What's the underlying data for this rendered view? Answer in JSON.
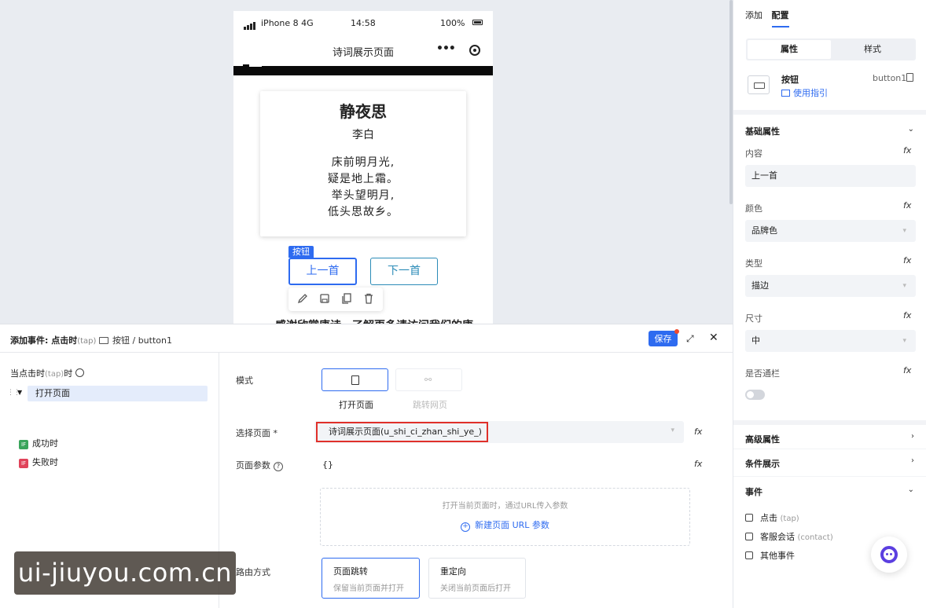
{
  "phone": {
    "carrier": "iPhone 8  4G",
    "time": "14:58",
    "battery": "100%",
    "page_title": "诗词展示页面",
    "more": "•••",
    "poem": {
      "title": "静夜思",
      "author": "李白",
      "lines": [
        "床前明月光,",
        "疑是地上霜。",
        "举头望明月,",
        "低头思故乡。"
      ]
    },
    "selected_tag": "按钮",
    "prev_button": "上一首",
    "next_button": "下一首",
    "cut_text": "感谢欣赏唐诗，了解更多请访问我们的康"
  },
  "right_panel": {
    "tabs": [
      "添加",
      "配置"
    ],
    "segment": [
      "属性",
      "样式"
    ],
    "component": {
      "name": "按钮",
      "id": "button1",
      "guide": "使用指引"
    },
    "basic_section": "基础属性",
    "props": {
      "content_label": "内容",
      "content_value": "上一首",
      "color_label": "颜色",
      "color_value": "品牌色",
      "type_label": "类型",
      "type_value": "描边",
      "size_label": "尺寸",
      "size_value": "中",
      "block_label": "是否通栏"
    },
    "fx": "fx",
    "advanced_section": "高级属性",
    "conditional_section": "条件展示",
    "events_section": "事件",
    "events": [
      {
        "label": "点击",
        "sub": "(tap)"
      },
      {
        "label": "客服会话",
        "sub": "(contact)"
      },
      {
        "label": "其他事件",
        "sub": ""
      }
    ]
  },
  "dialog": {
    "title": "添加事件: 点击时",
    "title_sub": "(tap)",
    "target": "按钮 / button1",
    "save": "保存",
    "tree": {
      "head": "当点击时",
      "head_sub": "(tap)",
      "head_end": "时",
      "action": "打开页面",
      "success": "成功时",
      "fail": "失败时",
      "if_badge": "IF"
    },
    "mode_label": "模式",
    "mode_open": "打开页面",
    "mode_jump": "跳转网页",
    "page_label": "选择页面 *",
    "page_value": "诗词展示页面(u_shi_ci_zhan_shi_ye_)",
    "params_label": "页面参数",
    "params_value": "{}",
    "params_hint": "打开当前页面时，通过URL传入参数",
    "params_add": "新建页面 URL 参数",
    "route_label": "路由方式",
    "route_push_title": "页面跳转",
    "route_push_desc": "保留当前页面并打开",
    "route_redirect_title": "重定向",
    "route_redirect_desc": "关闭当前页面后打开"
  },
  "watermark": "ui-jiuyou.com.cn"
}
